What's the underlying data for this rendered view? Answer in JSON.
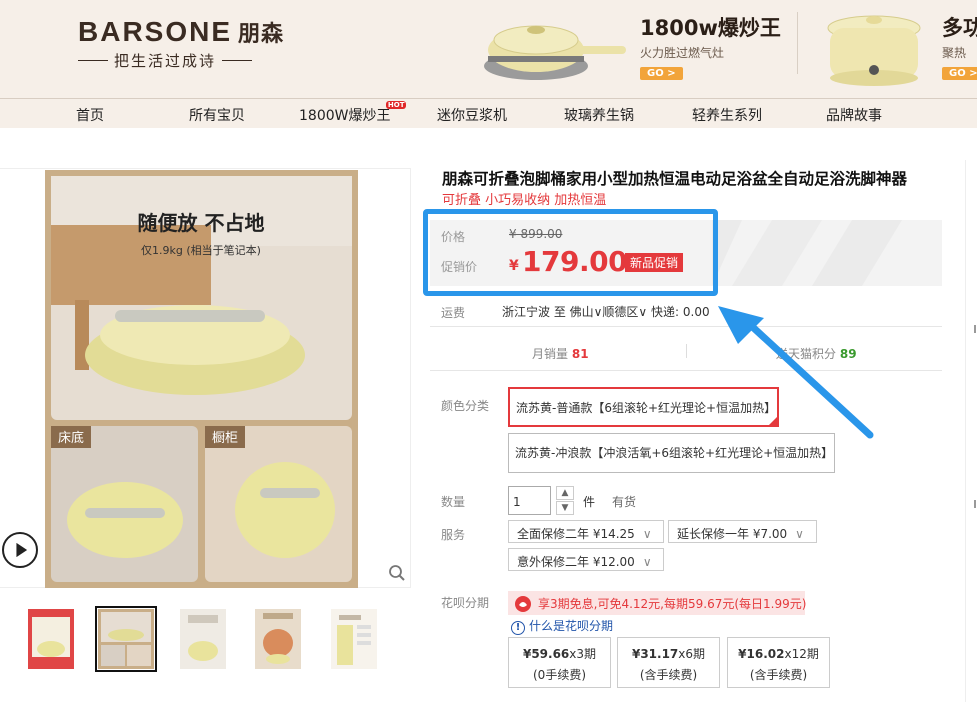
{
  "banner": {
    "brand": "BARSONE",
    "brand_cn": "朋森",
    "slogan": "把生活过成诗",
    "promo1": {
      "title": "1800w爆炒王",
      "sub": "火力胜过燃气灶",
      "go": "GO >"
    },
    "promo2": {
      "title": "多功",
      "sub": "聚热",
      "go": "GO >"
    }
  },
  "nav": {
    "items": [
      "首页",
      "所有宝贝",
      "1800W爆炒王",
      "迷你豆浆机",
      "玻璃养生锅",
      "轻养生系列",
      "品牌故事"
    ],
    "hot": "HOT"
  },
  "gallery": {
    "headline": "随便放 不占地",
    "subline": "仅1.9kg (相当于笔记本)",
    "tag_left": "床底",
    "tag_right": "橱柜"
  },
  "product": {
    "title": "朋森可折叠泡脚桶家用小型加热恒温电动足浴盆全自动足浴洗脚神器",
    "subtitle": "可折叠 小巧易收纳 加热恒温",
    "price_label": "价格",
    "old_price": "¥ 899.00",
    "promo_label": "促销价",
    "yen": "¥",
    "price": "179.00",
    "badge": "新品促销",
    "shipping_label": "运费",
    "shipping": "浙江宁波 至 佛山∨顺德区∨ 快递: 0.00",
    "sales_label": "月销量",
    "sales_value": "81",
    "points_label": "送天猫积分",
    "points_value": "89",
    "color_label": "颜色分类",
    "skus": [
      "流苏黄-普通款【6组滚轮+红光理论+恒温加热】",
      "流苏黄-冲浪款【冲浪活氧+6组滚轮+红光理论+恒温加热】"
    ],
    "qty_label": "数量",
    "qty_value": "1",
    "qty_unit": "件",
    "stock": "有货",
    "service_label": "服务",
    "services": [
      "全面保修二年 ¥14.25",
      "延长保修一年 ¥7.00",
      "意外保修二年 ¥12.00"
    ],
    "huabei_label": "花呗分期",
    "huabei_promo": "享3期免息,可免4.12元,每期59.67元(每日1.99元)",
    "huabei_info": "什么是花呗分期",
    "installments": [
      {
        "amount": "¥59.66",
        "period": "x3期",
        "fee": "(0手续费)"
      },
      {
        "amount": "¥31.17",
        "period": "x6期",
        "fee": "(含手续费)"
      },
      {
        "amount": "¥16.02",
        "period": "x12期",
        "fee": "(含手续费)"
      }
    ]
  },
  "colors": {
    "accent": "#e4393c",
    "highlight": "#2a96ea",
    "banner_bg": "#f6efe8"
  }
}
